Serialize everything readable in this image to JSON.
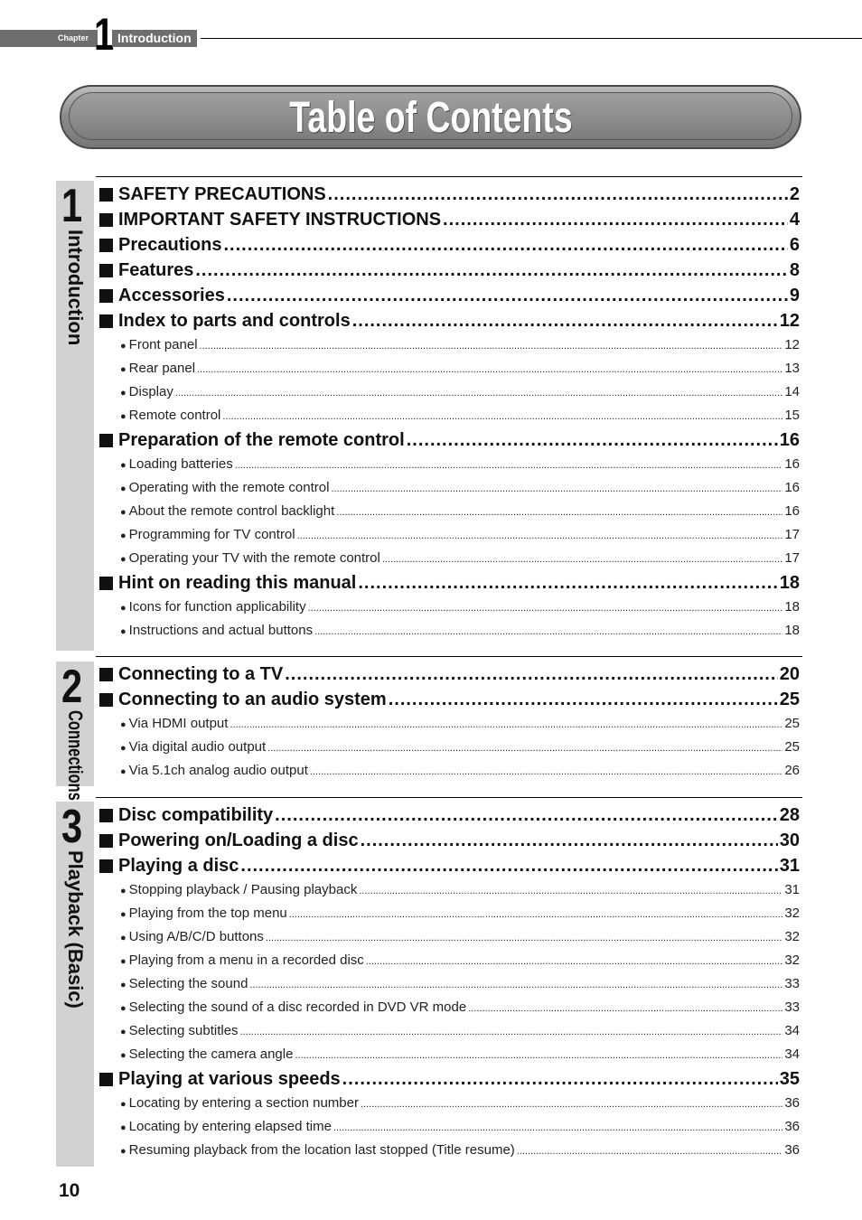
{
  "header": {
    "chapter_label": "Chapter",
    "chapter_number": "1",
    "chapter_title": "Introduction"
  },
  "title": "Table of Contents",
  "sections": [
    {
      "number": "1",
      "label": "Introduction",
      "entries": [
        {
          "type": "main",
          "text": "SAFETY PRECAUTIONS",
          "page": "2"
        },
        {
          "type": "main",
          "text": "IMPORTANT SAFETY INSTRUCTIONS",
          "page": "4"
        },
        {
          "type": "main",
          "text": "Precautions",
          "page": "6"
        },
        {
          "type": "main",
          "text": "Features",
          "page": "8"
        },
        {
          "type": "main",
          "text": "Accessories",
          "page": "9"
        },
        {
          "type": "main",
          "text": "Index to parts and controls",
          "page": "12"
        },
        {
          "type": "sub",
          "text": "Front panel",
          "page": "12"
        },
        {
          "type": "sub",
          "text": "Rear panel",
          "page": "13"
        },
        {
          "type": "sub",
          "text": "Display",
          "page": "14"
        },
        {
          "type": "sub",
          "text": "Remote control",
          "page": "15"
        },
        {
          "type": "main",
          "text": "Preparation of the remote control",
          "page": "16"
        },
        {
          "type": "sub",
          "text": "Loading batteries",
          "page": "16"
        },
        {
          "type": "sub",
          "text": "Operating with the remote control",
          "page": "16"
        },
        {
          "type": "sub",
          "text": "About the remote control backlight",
          "page": "16"
        },
        {
          "type": "sub",
          "text": "Programming for TV control",
          "page": "17"
        },
        {
          "type": "sub",
          "text": "Operating your TV with the remote control",
          "page": "17"
        },
        {
          "type": "main",
          "text": "Hint on reading this manual",
          "page": "18"
        },
        {
          "type": "sub",
          "text": "Icons for function applicability",
          "page": "18"
        },
        {
          "type": "sub",
          "text": "Instructions and actual buttons",
          "page": "18"
        }
      ]
    },
    {
      "number": "2",
      "label": "Connections",
      "entries": [
        {
          "type": "main",
          "text": "Connecting to a TV",
          "page": "20"
        },
        {
          "type": "main",
          "text": "Connecting to an audio system",
          "page": "25"
        },
        {
          "type": "sub",
          "text": "Via HDMI output",
          "page": "25"
        },
        {
          "type": "sub",
          "text": "Via digital audio output",
          "page": "25"
        },
        {
          "type": "sub",
          "text": "Via 5.1ch analog audio output",
          "page": "26"
        }
      ]
    },
    {
      "number": "3",
      "label": "Playback (Basic)",
      "entries": [
        {
          "type": "main",
          "text": "Disc compatibility",
          "page": "28"
        },
        {
          "type": "main",
          "text": "Powering on/Loading a disc",
          "page": "30"
        },
        {
          "type": "main",
          "text": "Playing a disc",
          "page": "31"
        },
        {
          "type": "sub",
          "text": "Stopping playback / Pausing playback",
          "page": "31"
        },
        {
          "type": "sub",
          "text": "Playing from the top menu",
          "page": "32"
        },
        {
          "type": "sub",
          "text": "Using A/B/C/D buttons",
          "page": "32"
        },
        {
          "type": "sub",
          "text": "Playing from a menu in a recorded disc",
          "page": "32"
        },
        {
          "type": "sub",
          "text": "Selecting the sound",
          "page": "33"
        },
        {
          "type": "sub",
          "text": "Selecting the sound of a disc recorded in DVD VR mode",
          "page": "33"
        },
        {
          "type": "sub",
          "text": "Selecting subtitles",
          "page": "34"
        },
        {
          "type": "sub",
          "text": "Selecting the camera angle",
          "page": "34"
        },
        {
          "type": "main",
          "text": "Playing at various speeds",
          "page": "35"
        },
        {
          "type": "sub",
          "text": "Locating by entering a section number",
          "page": "36"
        },
        {
          "type": "sub",
          "text": "Locating by entering elapsed time",
          "page": "36"
        },
        {
          "type": "sub",
          "text": "Resuming playback from the location last stopped (Title resume)",
          "page": "36"
        }
      ]
    }
  ],
  "page_number": "10"
}
